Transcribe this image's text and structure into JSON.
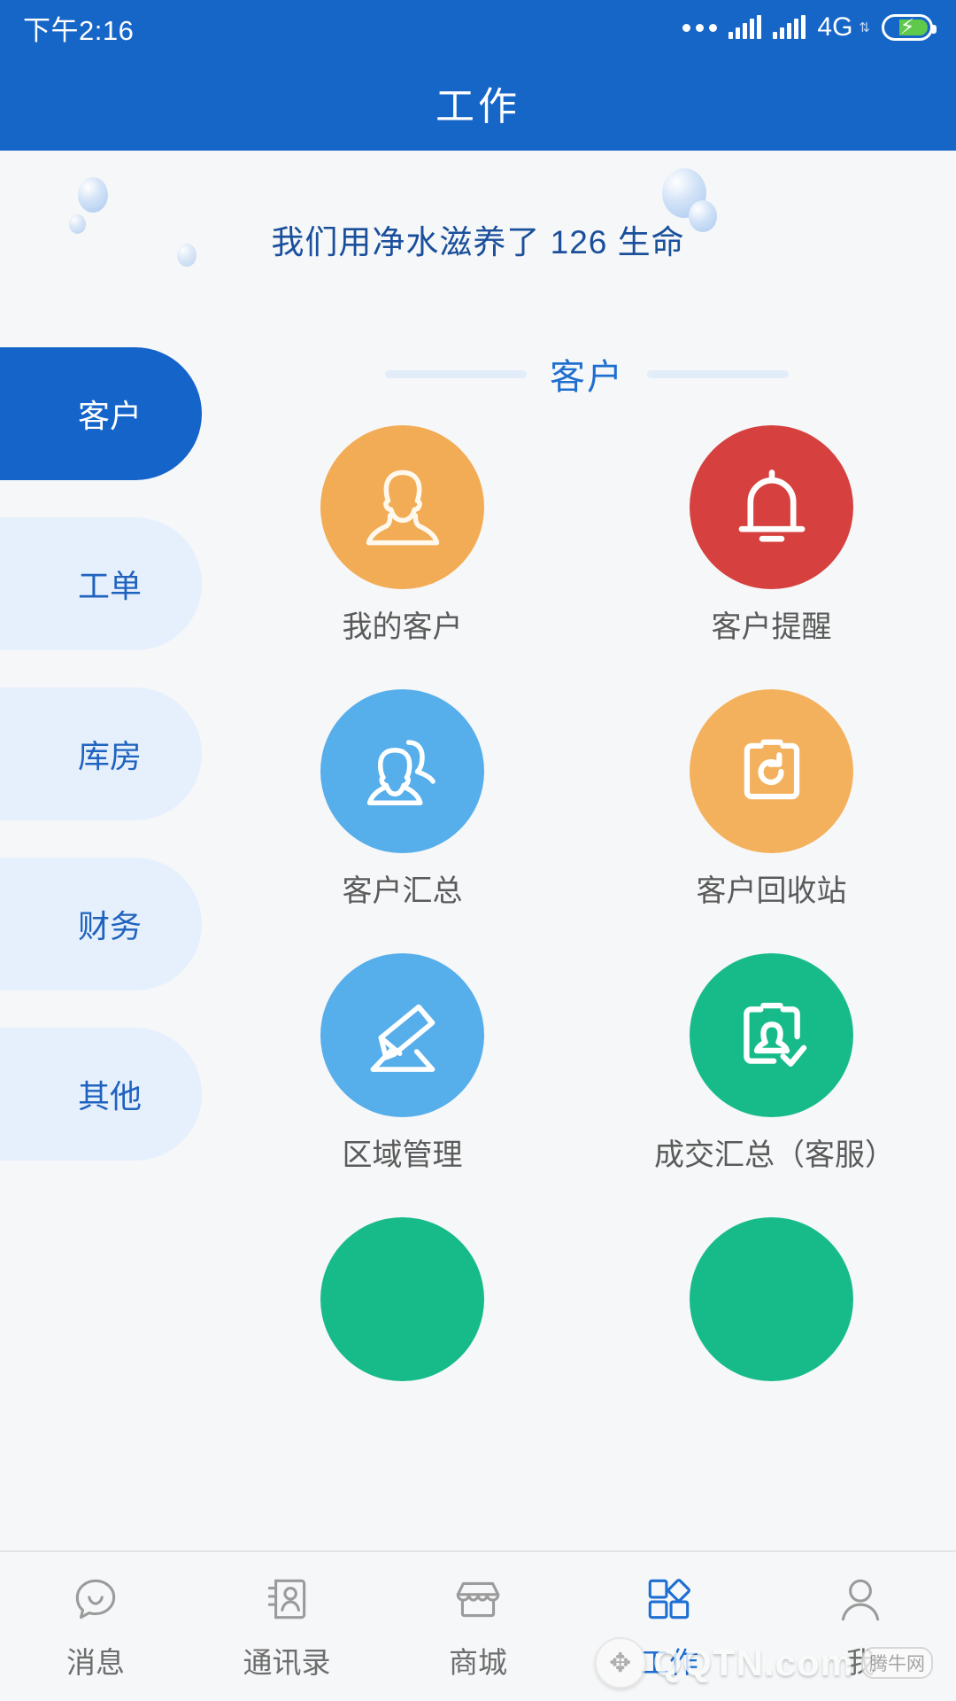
{
  "statusbar": {
    "time": "下午2:16",
    "network": "4G",
    "dots_icon": "more-dots-icon",
    "signal1_icon": "signal-bars-icon",
    "signal2_icon": "signal-bars-icon",
    "updown_icon": "data-transfer-icon",
    "battery_icon": "battery-charging-icon"
  },
  "header": {
    "title": "工作"
  },
  "banner": {
    "text": "我们用净水滋养了 126 生命",
    "count": "126"
  },
  "sidebar": {
    "items": [
      {
        "label": "客户",
        "active": true
      },
      {
        "label": "工单",
        "active": false
      },
      {
        "label": "库房",
        "active": false
      },
      {
        "label": "财务",
        "active": false
      },
      {
        "label": "其他",
        "active": false
      }
    ]
  },
  "section": {
    "title": "客户"
  },
  "tiles": [
    {
      "label": "我的客户",
      "icon": "person-icon",
      "color": "#f2ac55"
    },
    {
      "label": "客户提醒",
      "icon": "bell-icon",
      "color": "#d6413f"
    },
    {
      "label": "客户汇总",
      "icon": "people-group-icon",
      "color": "#56aeeb"
    },
    {
      "label": "客户回收站",
      "icon": "clipboard-restore-icon",
      "color": "#f4b15d"
    },
    {
      "label": "区域管理",
      "icon": "pencil-edit-icon",
      "color": "#56aeeb"
    },
    {
      "label": "成交汇总（客服）",
      "icon": "clipboard-person-check-icon",
      "color": "#17bb8a"
    },
    {
      "label": "",
      "icon": "partial-tile-icon",
      "color": "#17bb8a"
    },
    {
      "label": "",
      "icon": "partial-tile-icon",
      "color": "#17bb8a"
    }
  ],
  "tabbar": {
    "items": [
      {
        "label": "消息",
        "icon": "chat-bubble-icon",
        "active": false
      },
      {
        "label": "通讯录",
        "icon": "contacts-book-icon",
        "active": false
      },
      {
        "label": "商城",
        "icon": "shop-icon",
        "active": false
      },
      {
        "label": "工作",
        "icon": "apps-grid-icon",
        "active": true
      },
      {
        "label": "我",
        "icon": "user-profile-icon",
        "active": false
      }
    ]
  },
  "watermark": {
    "main": "QQTN.com",
    "cn": "腾牛网",
    "logo_icon": "qqtn-logo-icon"
  },
  "colors": {
    "brand_blue": "#1666c8",
    "active_tab_blue": "#1d6fd4",
    "page_bg": "#f6f7f8",
    "sidebar_inactive": "#e6f0fd"
  }
}
